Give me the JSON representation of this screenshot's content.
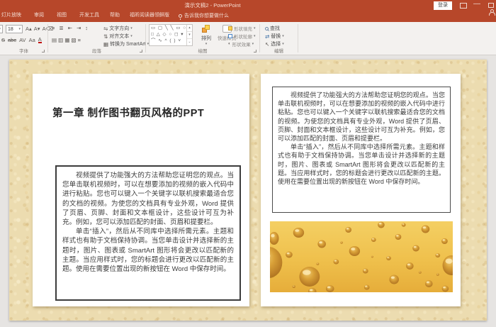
{
  "window": {
    "title": "演示文稿2 - PowerPoint",
    "login_label": "登录",
    "minimize_glyph": "—"
  },
  "tabs": {
    "items": [
      "灯片放映",
      "审阅",
      "视图",
      "开发工具",
      "帮助",
      "福昕阅读器领鲜版"
    ],
    "tell_me": "告诉我你想要做什么"
  },
  "ribbon": {
    "font": {
      "group_label": "字体",
      "size_value": "18",
      "grow_glyph": "A▴",
      "shrink_glyph": "A▾",
      "clear_glyph": "A⌫",
      "strikethrough_glyph": "S",
      "abc_glyph": "abc",
      "spacing_glyph": "AV",
      "case_glyph": "Aa",
      "color_glyph": "A"
    },
    "paragraph": {
      "group_label": "段落",
      "bullets_glyph": "≡",
      "numbering_glyph": "≣",
      "indent_dec_glyph": "⇤",
      "indent_inc_glyph": "⇥",
      "spacing_glyph": "↕",
      "align_row_glyph": "▤ ▥ ▦ ▧ ≡",
      "text_direction_icon": "⇋",
      "text_direction": "文字方向",
      "align_text_icon": "⇅",
      "align_text": "对齐文本",
      "smartart_icon": "▦",
      "smartart": "转换为 SmartArt"
    },
    "drawing": {
      "group_label": "绘图",
      "shape_row_1": "▭ ▢ ╲ ╲ ▭ ○",
      "shape_row_2": "□ △ ◇ ○ ◻ ▾",
      "shape_row_3": "⌒ ∿ ^ ( ) ˅",
      "arrange": "排列",
      "quick_styles": "快速样式",
      "shape_fill": "形状填充",
      "shape_outline": "形状轮廓",
      "effects_icon": "◐",
      "shape_effects": "形状效果"
    },
    "editing": {
      "group_label": "编辑",
      "find": "查找",
      "replace_icon": "⇄",
      "replace": "替换",
      "select_icon": "↖",
      "select": "选择",
      "dropdown_glyph": "▾"
    }
  },
  "slide": {
    "title": "第一章 制作图书翻页风格的PPT",
    "paragraph1": "视频提供了功能强大的方法帮助您证明您的观点。当您单击联机视频时，可以在想要添加的视频的嵌入代码中进行粘贴。您也可以键入一个关键字以联机搜索最适合您的文档的视频。为使您的文档具有专业外观，Word 提供了页眉、页脚、封面和文本框设计，这些设计可互为补充。例如，您可以添加匹配的封面、页眉和提要栏。",
    "paragraph2": "单击“插入”，然后从不同库中选择所需元素。主题和样式也有助于文档保持协调。当您单击设计并选择新的主题时，图片、图表或 SmartArt 图形将会更改以匹配新的主题。当应用样式时，您的标题会进行更改以匹配新的主题。使用在需要位置出现的新按钮在 Word 中保存时间。"
  },
  "cheese": {
    "base_top": "#f4cf63",
    "base_mid": "#efc04c",
    "base_bottom": "#e6ad3a",
    "hole_light": "#f1cf79",
    "hole_mid": "#d9a138",
    "hole_dark": "#a9701e",
    "holes": [
      [
        -2,
        58,
        20,
        22
      ],
      [
        6,
        24,
        7,
        9
      ],
      [
        42,
        16,
        8,
        7
      ],
      [
        76,
        32,
        6,
        5.5
      ],
      [
        28,
        47,
        5,
        4.5
      ],
      [
        58,
        78,
        15,
        14
      ],
      [
        97,
        57,
        4,
        3.5
      ],
      [
        88,
        95,
        6,
        5
      ],
      [
        115,
        12,
        4.5,
        4
      ],
      [
        124,
        42,
        8,
        7
      ],
      [
        140,
        70,
        4,
        3.5
      ],
      [
        152,
        26,
        3.5,
        3
      ],
      [
        163,
        5,
        5,
        4.5
      ],
      [
        174,
        52,
        3.5,
        3
      ],
      [
        188,
        22,
        4.5,
        4
      ],
      [
        182,
        82,
        7,
        6.5
      ],
      [
        205,
        63,
        5.5,
        5
      ],
      [
        214,
        38,
        5,
        4.5
      ],
      [
        228,
        11,
        6,
        5.5
      ],
      [
        233,
        88,
        5.5,
        5
      ],
      [
        246,
        48,
        3.5,
        3
      ],
      [
        256,
        28,
        4.5,
        4
      ],
      [
        266,
        62,
        13,
        14
      ],
      [
        142,
        93,
        4,
        3.5
      ],
      [
        62,
        99,
        6,
        5
      ],
      [
        105,
        30,
        1.8,
        1.6
      ],
      [
        150,
        50,
        1.6,
        1.4
      ],
      [
        70,
        60,
        2,
        1.8
      ],
      [
        220,
        72,
        2,
        1.8
      ],
      [
        35,
        92,
        2.2,
        2
      ],
      [
        257,
        95,
        5,
        4.5
      ],
      [
        196,
        5,
        3,
        2.6
      ],
      [
        246,
        75,
        2,
        1.8
      ]
    ]
  },
  "colors": {
    "titlebar": "#b7472a",
    "ribbon_bg": "#f3f1ef",
    "workspace_bg": "#e6e4e2",
    "parchment": "#ecdcb0"
  }
}
